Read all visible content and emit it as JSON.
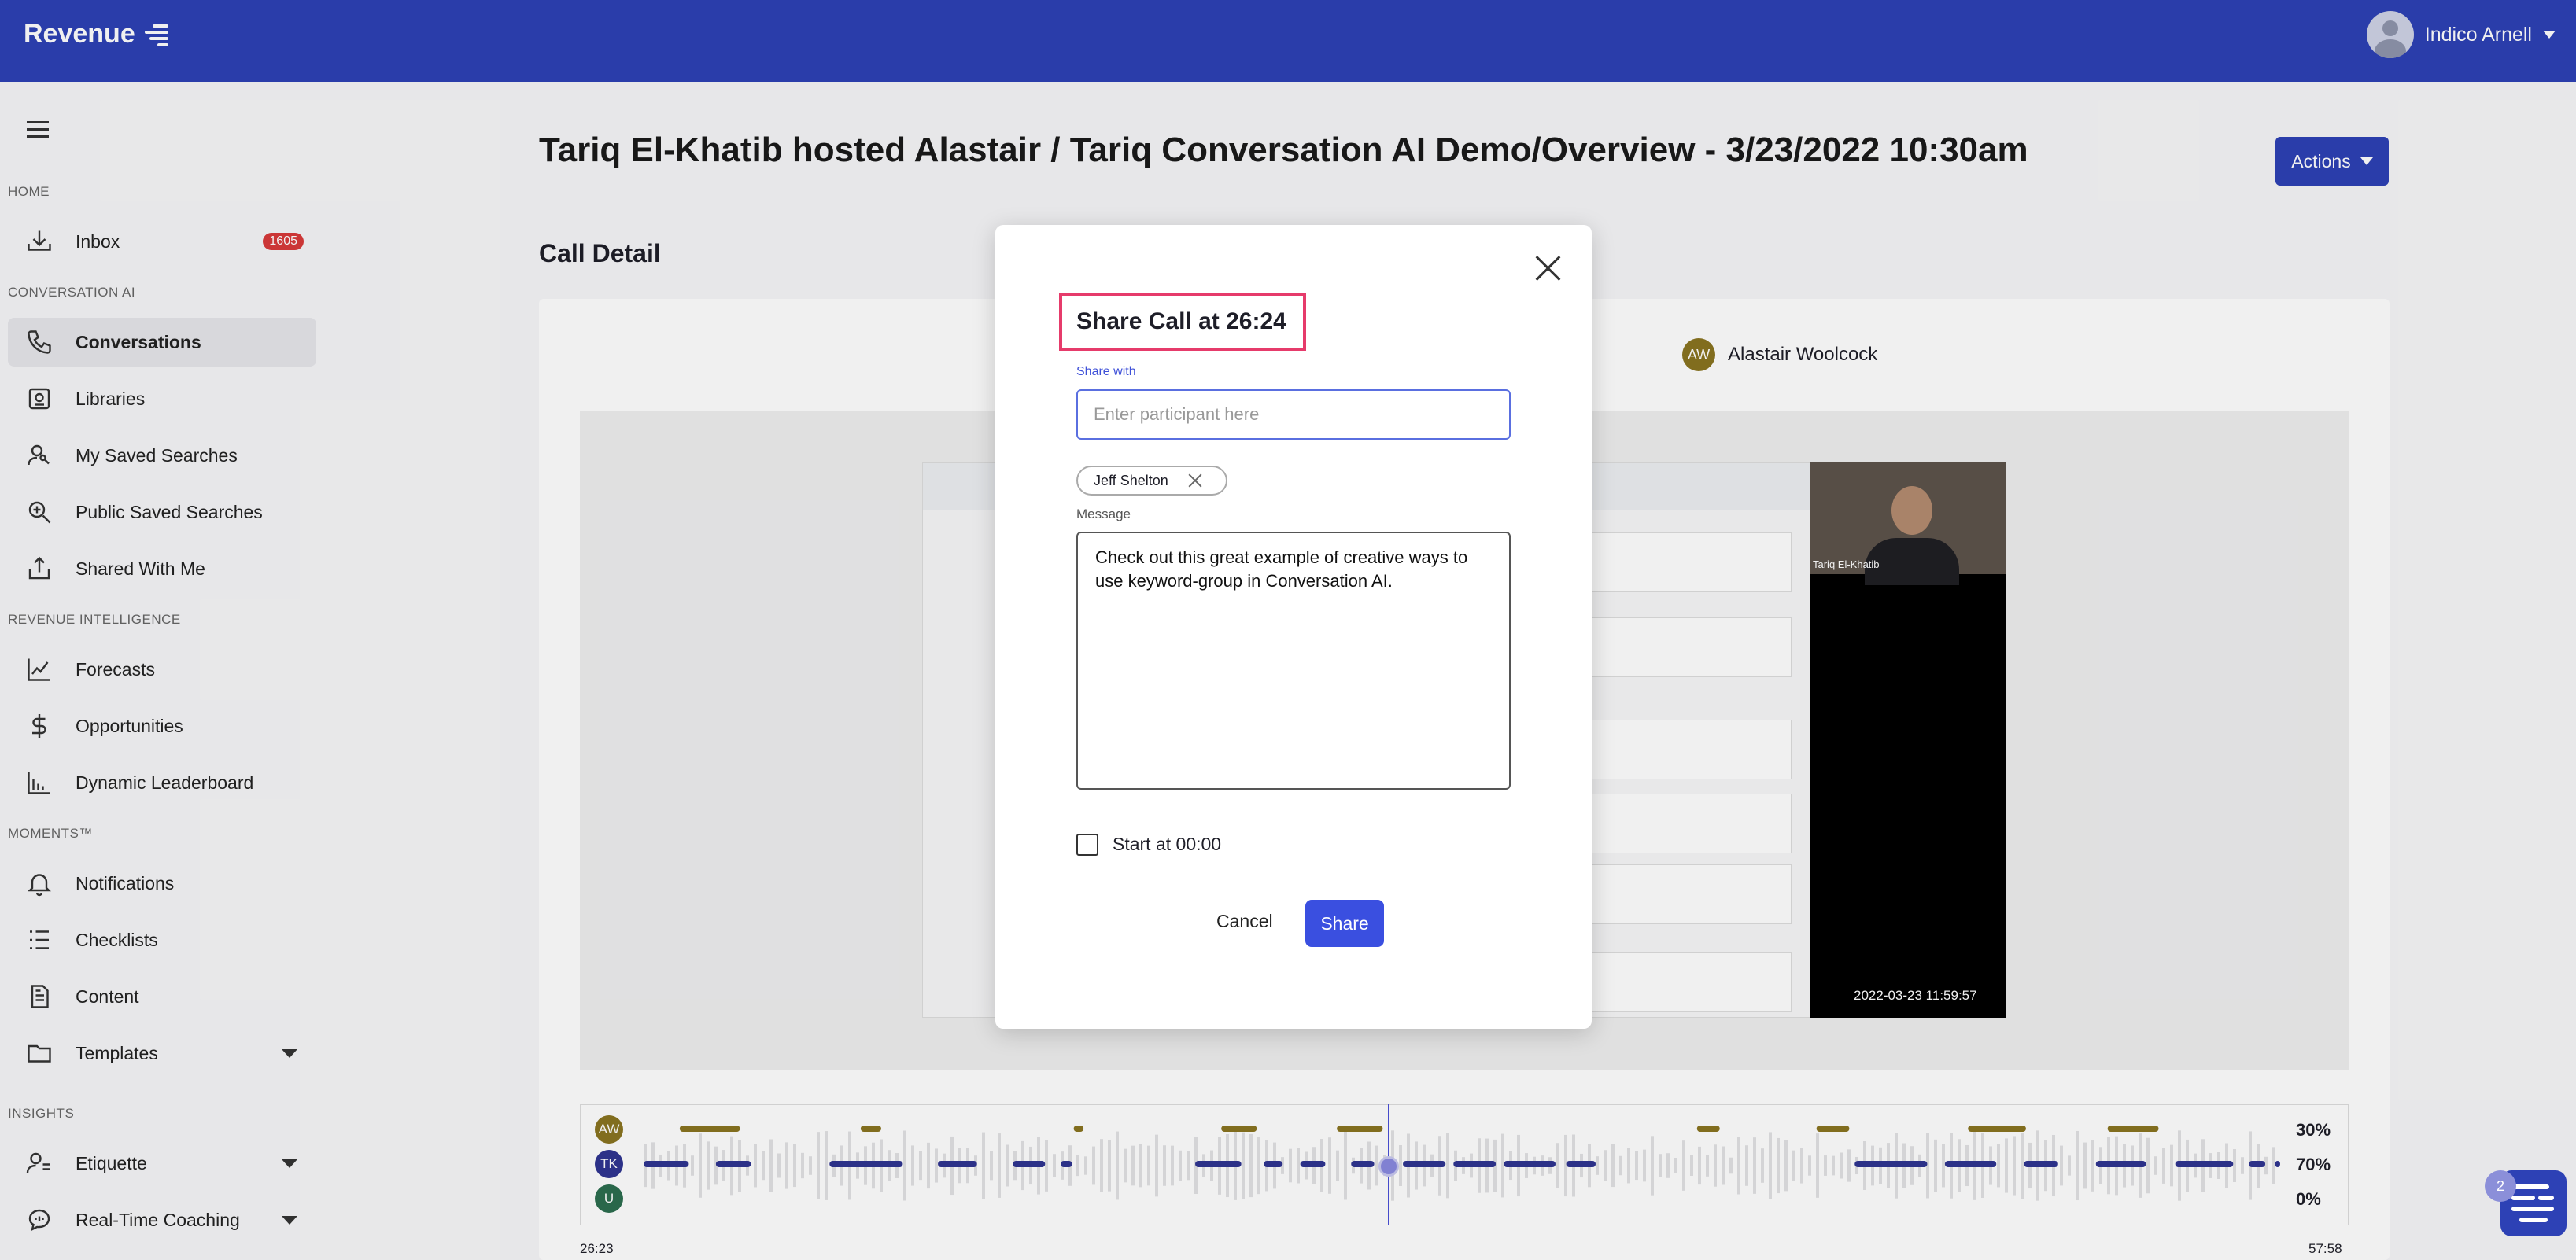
{
  "app": {
    "brand": "Revenue",
    "user_name": "Indico Arnell"
  },
  "sidebar": {
    "sections": [
      {
        "label": "HOME"
      },
      {
        "label": "CONVERSATION AI"
      },
      {
        "label": "REVENUE INTELLIGENCE"
      },
      {
        "label": "MOMENTS™"
      },
      {
        "label": "INSIGHTS"
      }
    ],
    "items": [
      {
        "label": "Inbox",
        "icon": "inbox-icon",
        "badge": "1605"
      },
      {
        "label": "Conversations",
        "icon": "phone-icon",
        "active": true
      },
      {
        "label": "Libraries",
        "icon": "library-icon"
      },
      {
        "label": "My Saved Searches",
        "icon": "user-search-icon"
      },
      {
        "label": "Public Saved Searches",
        "icon": "zoom-icon"
      },
      {
        "label": "Shared With Me",
        "icon": "share-icon"
      },
      {
        "label": "Forecasts",
        "icon": "line-chart-icon"
      },
      {
        "label": "Opportunities",
        "icon": "dollar-icon"
      },
      {
        "label": "Dynamic Leaderboard",
        "icon": "bar-chart-icon"
      },
      {
        "label": "Notifications",
        "icon": "bell-icon"
      },
      {
        "label": "Checklists",
        "icon": "checklist-icon"
      },
      {
        "label": "Content",
        "icon": "document-icon"
      },
      {
        "label": "Templates",
        "icon": "folder-icon"
      },
      {
        "label": "Etiquette",
        "icon": "etiquette-icon"
      },
      {
        "label": "Real-Time Coaching",
        "icon": "coaching-icon"
      }
    ]
  },
  "main": {
    "title": "Tariq El-Khatib hosted Alastair / Tariq Conversation AI Demo/Overview - 3/23/2022 10:30am",
    "actions_label": "Actions",
    "call_detail_heading": "Call Detail",
    "participant": {
      "initials": "AW",
      "name": "Alastair Woolcock"
    },
    "video": {
      "cam_name": "Tariq El-Khatib",
      "timestamp": "2022-03-23 11:59:57"
    }
  },
  "modal": {
    "title": "Share Call at 26:24",
    "share_with_label": "Share with",
    "share_with_placeholder": "Enter participant here",
    "chips": [
      "Jeff Shelton"
    ],
    "message_label": "Message",
    "message_value": "Check out this great example of creative ways to use keyword-group in Conversation AI.",
    "start_at_label": "Start at 00:00",
    "start_at_checked": false,
    "cancel_label": "Cancel",
    "share_label": "Share"
  },
  "timeline": {
    "speakers": [
      {
        "initials": "AW",
        "percent": "30%",
        "color": "#8a7420"
      },
      {
        "initials": "TK",
        "percent": "70%",
        "color": "#2f3591"
      },
      {
        "initials": "U",
        "percent": "0%",
        "color": "#2c6e4f"
      }
    ],
    "current_time": "26:23",
    "duration": "57:58"
  },
  "chat_widget": {
    "count": "2"
  },
  "colors": {
    "brand": "#2d41b5",
    "accent": "#3a4fe0",
    "highlight": "#e63b6b",
    "badge": "#d83a3a"
  }
}
